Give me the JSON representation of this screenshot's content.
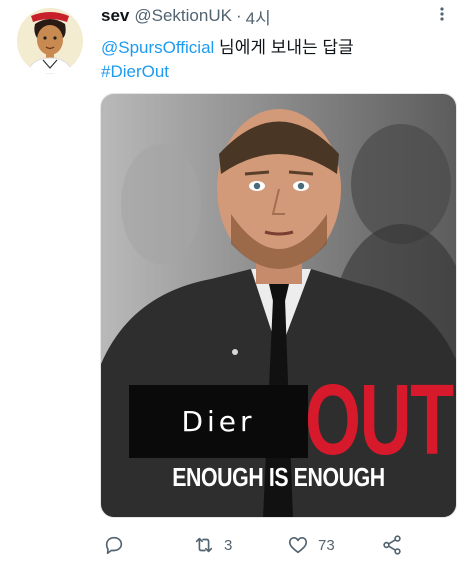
{
  "tweet": {
    "display_name": "sev",
    "handle": "@SektionUK",
    "separator": "·",
    "time": "4시",
    "reply_to_handle": "@SpursOfficial",
    "reply_suffix": " 님에게 보내는 답글",
    "hashtag": "#DierOut"
  },
  "media": {
    "dier_label": "Dier",
    "out_label": "OUT",
    "slogan": "ENOUGH IS ENOUGH",
    "colors": {
      "out": "#d6192b",
      "box": "#0a0a0a"
    }
  },
  "actions": {
    "reply": {
      "icon": "reply-icon"
    },
    "retweet": {
      "icon": "retweet-icon",
      "count": "3"
    },
    "like": {
      "icon": "heart-icon",
      "count": "73"
    },
    "share": {
      "icon": "share-icon"
    }
  },
  "colors": {
    "link": "#1d9bf0",
    "secondary_text": "#536471",
    "primary_text": "#0f1419"
  }
}
